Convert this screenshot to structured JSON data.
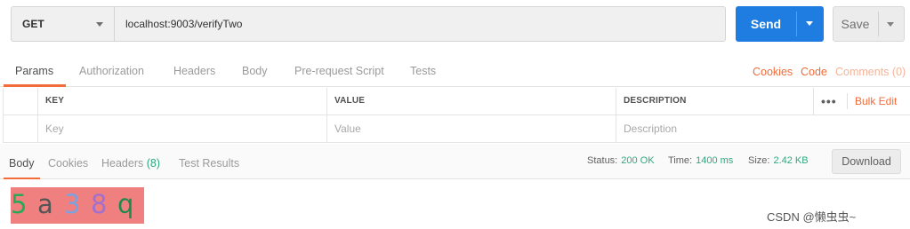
{
  "request": {
    "method": "GET",
    "url": "localhost:9003/verifyTwo",
    "send_label": "Send",
    "save_label": "Save"
  },
  "request_tabs": {
    "items": [
      "Params",
      "Authorization",
      "Headers",
      "Body",
      "Pre-request Script",
      "Tests"
    ],
    "active": "Params",
    "cookies_label": "Cookies",
    "code_label": "Code",
    "comments_label": "Comments (0)"
  },
  "params_table": {
    "headers": {
      "key": "KEY",
      "value": "VALUE",
      "description": "DESCRIPTION"
    },
    "placeholders": {
      "key": "Key",
      "value": "Value",
      "description": "Description"
    },
    "more_label": "•••",
    "bulk_edit_label": "Bulk Edit"
  },
  "response_tabs": {
    "body": "Body",
    "cookies": "Cookies",
    "headers": "Headers",
    "headers_count": "(8)",
    "test_results": "Test Results",
    "active": "Body"
  },
  "response_status": {
    "status_label": "Status:",
    "status_value": "200 OK",
    "time_label": "Time:",
    "time_value": "1400 ms",
    "size_label": "Size:",
    "size_value": "2.42 KB",
    "download_label": "Download"
  },
  "captcha": {
    "characters": [
      "5",
      "a",
      "3",
      "8",
      "q"
    ],
    "colors": [
      "#2aa85a",
      "#555555",
      "#7aa2e0",
      "#a070d0",
      "#1e8a50"
    ],
    "background": "#f08080"
  },
  "watermark": "CSDN @懒虫虫~",
  "colors": {
    "accent": "#f26b3a",
    "send_button": "#1f7ce0",
    "status_ok": "#2ea87e"
  }
}
